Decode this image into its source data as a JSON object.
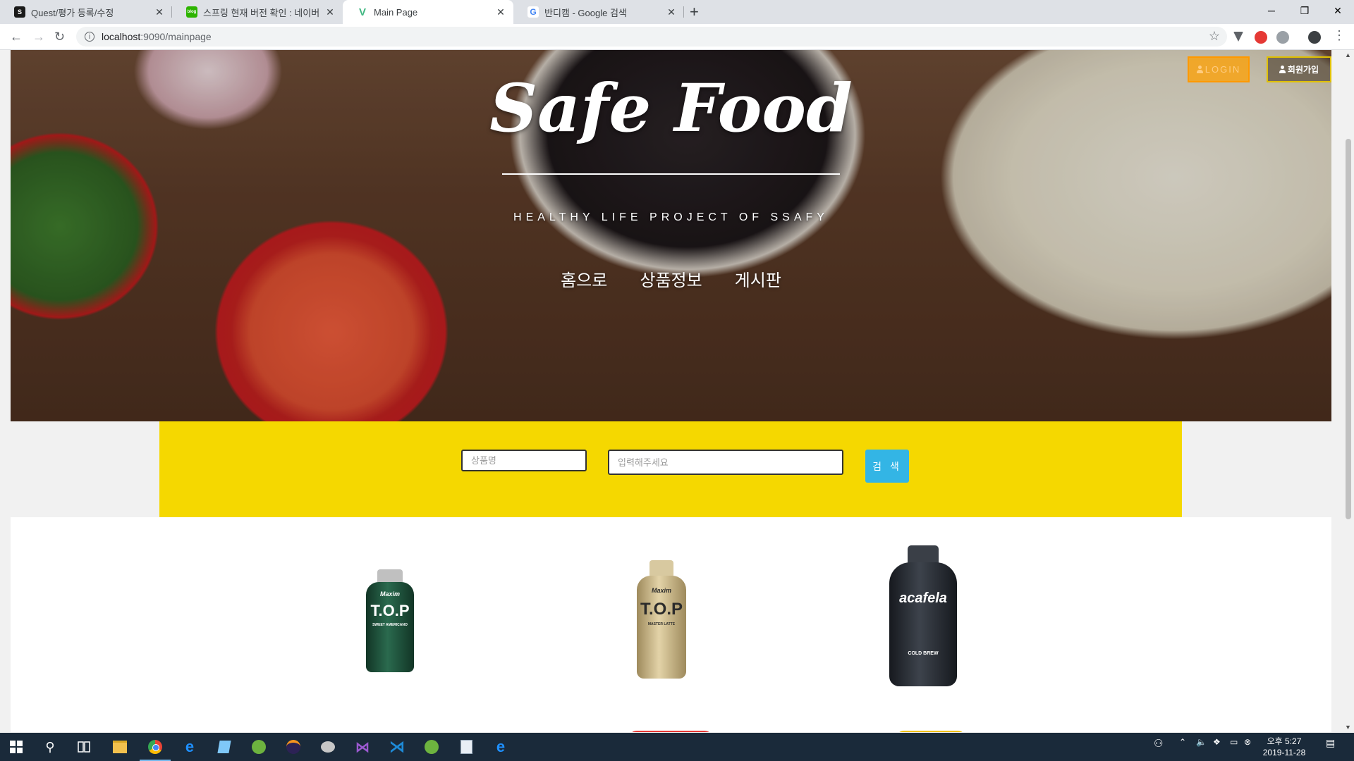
{
  "browser": {
    "tabs": [
      {
        "title": "Quest/평가 등록/수정",
        "favicon_color": "#1a1a1a",
        "favicon_glyph": "S",
        "active": false
      },
      {
        "title": "스프링 현재 버전 확인 : 네이버",
        "favicon_color": "#2db400",
        "favicon_glyph": "blog",
        "active": false
      },
      {
        "title": "Main Page",
        "favicon_color": "#42b883",
        "favicon_glyph": "V",
        "active": true
      },
      {
        "title": "반디캠 - Google 검색",
        "favicon_color": "#ffffff",
        "favicon_glyph": "G",
        "active": false
      }
    ],
    "new_tab": "+",
    "address": {
      "host": "localhost",
      "path": ":9090/mainpage"
    },
    "window_controls": [
      "─",
      "❐",
      "✕"
    ]
  },
  "header": {
    "site_title": "Safe Food",
    "subtitle": "HEALTHY LIFE PROJECT OF SSAFY",
    "menu": [
      "홈으로",
      "상품정보",
      "게시판"
    ],
    "login_label": "LOGIN",
    "signup_label": "회원가입"
  },
  "search": {
    "category_placeholder": "상품명",
    "query_placeholder": "입력해주세요",
    "button_label": "검 색"
  },
  "products": [
    {
      "brand": "Maxim",
      "name": "T.O.P",
      "variant": "SWEET AMERICANO",
      "color": "#1f4d3a",
      "cap": "#c0c0c0"
    },
    {
      "brand": "Maxim",
      "name": "T.O.P",
      "variant": "MASTER LATTE",
      "color": "#c9b485",
      "cap": "#d8c9a0"
    },
    {
      "brand": "",
      "name": "acafela",
      "variant": "COLD BREW",
      "color": "#2b2f36",
      "cap": "#3a3f47"
    }
  ],
  "taskbar": {
    "time": "오후 5:27",
    "date": "2019-11-28"
  }
}
